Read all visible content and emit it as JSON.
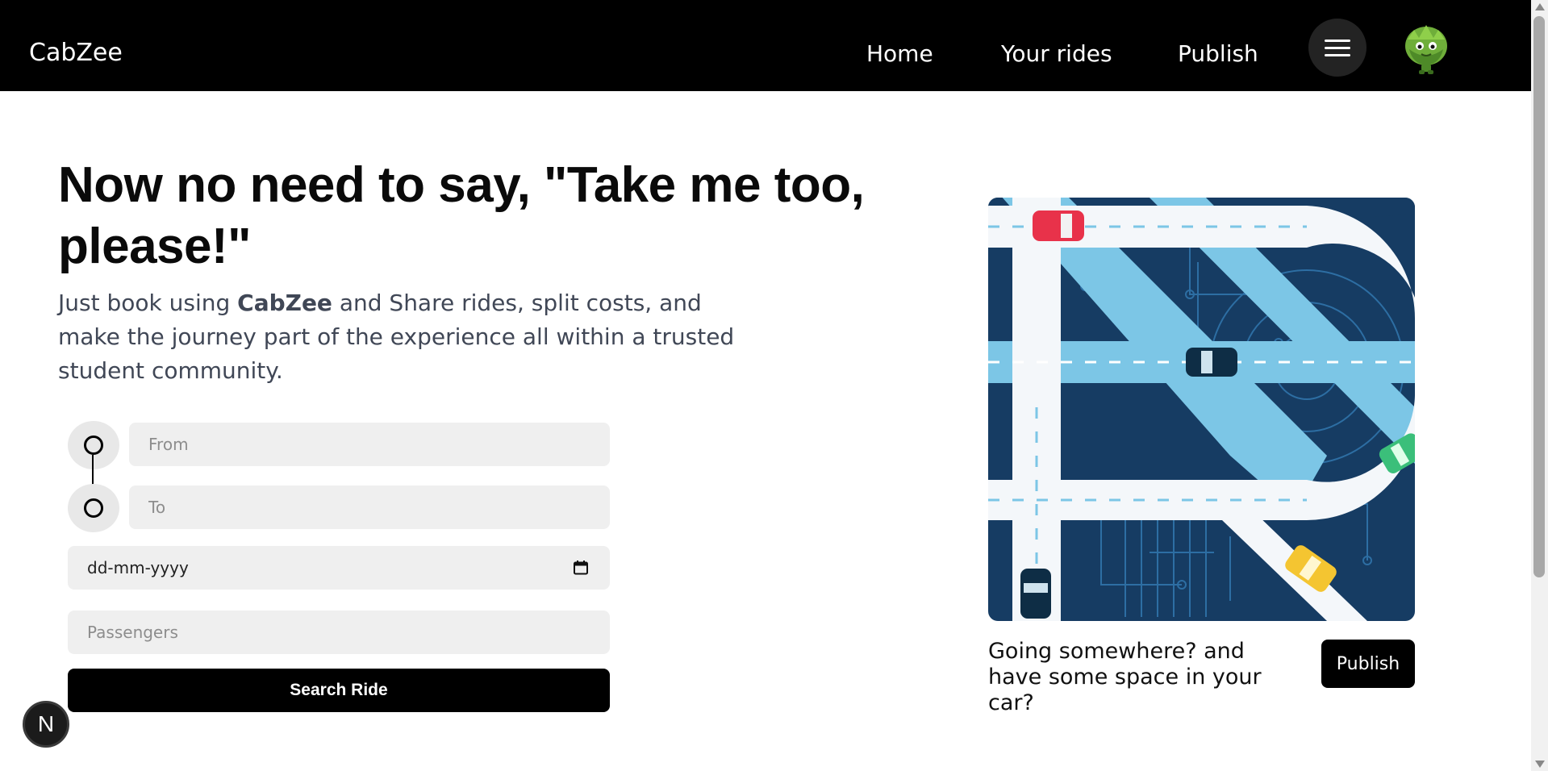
{
  "nav": {
    "brand": "CabZee",
    "links": [
      "Home",
      "Your rides",
      "Publish"
    ]
  },
  "hero": {
    "title": "Now no need to say, \"Take me too, please!\"",
    "subtitle_pre": "Just book using ",
    "subtitle_brand": "CabZee",
    "subtitle_post": " and Share rides, split costs, and make the journey part of the experience all within a trusted student community."
  },
  "form": {
    "from_placeholder": "From",
    "to_placeholder": "To",
    "date_value": "dd-mm-yyyy",
    "passengers_placeholder": "Passengers",
    "search_label": "Search Ride"
  },
  "cta": {
    "text": "Going somewhere? and have some space in your car?",
    "button_label": "Publish"
  },
  "badge": {
    "label": "N"
  },
  "colors": {
    "nav_bg": "#000000",
    "button_bg": "#000000",
    "field_bg": "#efefef",
    "subtitle": "#404756",
    "map_dark": "#163c63",
    "road": "#7cc6e6"
  },
  "icons": [
    "hamburger-menu-icon",
    "avatar",
    "location-from-icon",
    "location-to-icon",
    "calendar-icon",
    "scroll-arrow-icon"
  ]
}
